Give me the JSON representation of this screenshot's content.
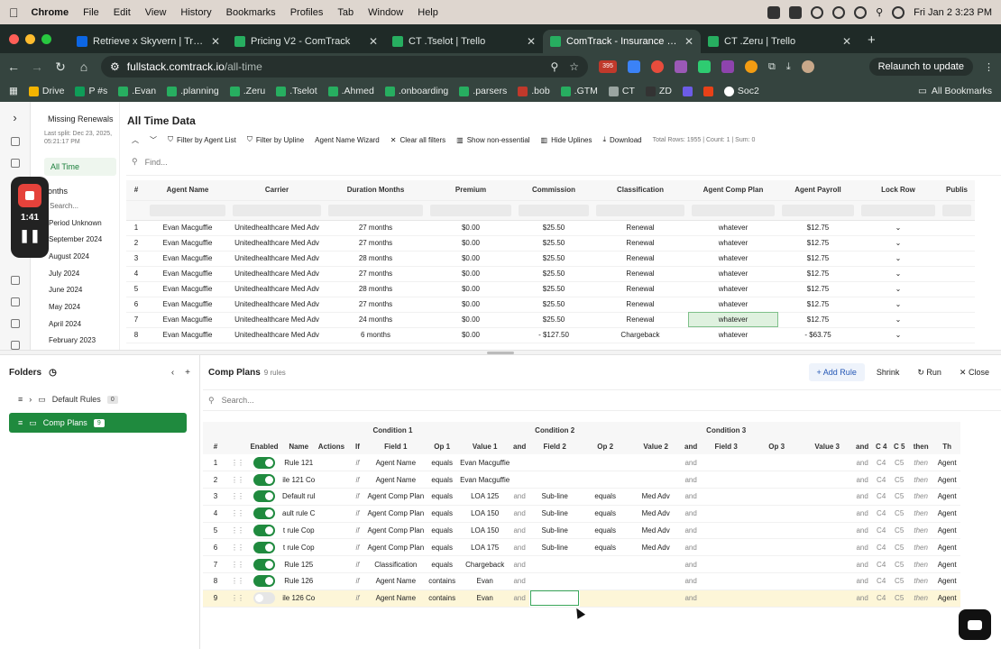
{
  "menubar": {
    "app": "Chrome",
    "items": [
      "File",
      "Edit",
      "View",
      "History",
      "Bookmarks",
      "Profiles",
      "Tab",
      "Window",
      "Help"
    ],
    "datetime": "Fri Jan 2  3:23 PM"
  },
  "tabs": [
    {
      "label": "Retrieve x Skyvern | Trello",
      "color": "#0c66e4",
      "active": false
    },
    {
      "label": "Pricing V2 - ComTrack",
      "color": "#27ae60",
      "active": false
    },
    {
      "label": "CT .Tselot | Trello",
      "color": "#27ae60",
      "active": false
    },
    {
      "label": "ComTrack - Insurance Comm",
      "color": "#27ae60",
      "active": true
    },
    {
      "label": "CT .Zeru | Trello",
      "color": "#27ae60",
      "active": false
    }
  ],
  "address": {
    "host": "fullstack.comtrack.io",
    "path": "/all-time",
    "relaunch": "Relaunch to update",
    "badge": "395"
  },
  "bookmarks": [
    "Drive",
    "P #s",
    ".Evan",
    ".planning",
    ".Zeru",
    ".Tselot",
    ".Ahmed",
    ".onboarding",
    ".parsers",
    ".bob",
    ".GTM",
    "CT",
    "ZD",
    "Soc2"
  ],
  "bookmarks_all": "All Bookmarks",
  "recorder": {
    "time": "1:41"
  },
  "period_panel": {
    "title": "Missing Renewals",
    "last_split": "Last split: Dec 23, 2025, 05:21:17 PM",
    "all_time": "All Time",
    "months": "onths",
    "search": "Search...",
    "items": [
      "Period Unknown",
      "September 2024",
      "August 2024",
      "July 2024",
      "June 2024",
      "May 2024",
      "April 2024",
      "February 2023"
    ]
  },
  "all_time": {
    "title": "All Time Data",
    "toolbar": {
      "filter_agent": "Filter by Agent List",
      "filter_upline": "Filter by Upline",
      "wizard": "Agent Name Wizard",
      "clear": "Clear all filters",
      "non_essential": "Show non-essential",
      "hide_uplines": "Hide Uplines",
      "download": "Download",
      "summary": "Total Rows: 1955 | Count: 1 | Sum: 0"
    },
    "find": "Find...",
    "headers": [
      "#",
      "Agent Name",
      "Carrier",
      "Duration Months",
      "Premium",
      "Commission",
      "Classification",
      "Agent Comp Plan",
      "Agent Payroll",
      "Lock Row",
      "Publis"
    ],
    "rows": [
      [
        "1",
        "Evan Macguffie",
        "Unitedhealthcare Med Adv",
        "27 months",
        "$0.00",
        "$25.50",
        "Renewal",
        "whatever",
        "$12.75"
      ],
      [
        "2",
        "Evan Macguffie",
        "Unitedhealthcare Med Adv",
        "27 months",
        "$0.00",
        "$25.50",
        "Renewal",
        "whatever",
        "$12.75"
      ],
      [
        "3",
        "Evan Macguffie",
        "Unitedhealthcare Med Adv",
        "28 months",
        "$0.00",
        "$25.50",
        "Renewal",
        "whatever",
        "$12.75"
      ],
      [
        "4",
        "Evan Macguffie",
        "Unitedhealthcare Med Adv",
        "27 months",
        "$0.00",
        "$25.50",
        "Renewal",
        "whatever",
        "$12.75"
      ],
      [
        "5",
        "Evan Macguffie",
        "Unitedhealthcare Med Adv",
        "28 months",
        "$0.00",
        "$25.50",
        "Renewal",
        "whatever",
        "$12.75"
      ],
      [
        "6",
        "Evan Macguffie",
        "Unitedhealthcare Med Adv",
        "27 months",
        "$0.00",
        "$25.50",
        "Renewal",
        "whatever",
        "$12.75"
      ],
      [
        "7",
        "Evan Macguffie",
        "Unitedhealthcare Med Adv",
        "24 months",
        "$0.00",
        "$25.50",
        "Renewal",
        "whatever",
        "$12.75"
      ],
      [
        "8",
        "Evan Macguffie",
        "Unitedhealthcare Med Adv",
        "6 months",
        "$0.00",
        "- $127.50",
        "Chargeback",
        "whatever",
        "- $63.75"
      ]
    ]
  },
  "folders": {
    "title": "Folders",
    "items": [
      {
        "label": "Default Rules",
        "count": "0"
      },
      {
        "label": "Comp Plans",
        "count": "9"
      }
    ]
  },
  "comp_plans": {
    "title": "Comp Plans",
    "count": "9 rules",
    "add_rule": "Add Rule",
    "shrink": "Shrink",
    "run": "Run",
    "close": "Close",
    "search": "Search...",
    "group_headers": [
      "Condition 1",
      "Condition 2",
      "Condition 3"
    ],
    "headers": [
      "#",
      "",
      "Enabled",
      "Name",
      "Actions",
      "If",
      "Field 1",
      "Op 1",
      "Value 1",
      "and",
      "Field 2",
      "Op 2",
      "Value 2",
      "and",
      "Field 3",
      "Op 3",
      "Value 3",
      "and",
      "C 4",
      "C 5",
      "then",
      "Th"
    ],
    "rows": [
      {
        "n": "1",
        "on": true,
        "name": "Rule 121",
        "f1": "Agent Name",
        "o1": "equals",
        "v1": "Evan Macguffie",
        "a1": "",
        "f2": "",
        "o2": "",
        "v2": ""
      },
      {
        "n": "2",
        "on": true,
        "name": "ile 121 Co",
        "f1": "Agent Name",
        "o1": "equals",
        "v1": "Evan Macguffie",
        "a1": "",
        "f2": "",
        "o2": "",
        "v2": ""
      },
      {
        "n": "3",
        "on": true,
        "name": "Default rul",
        "f1": "Agent Comp Plan",
        "o1": "equals",
        "v1": "LOA 125",
        "a1": "and",
        "f2": "Sub-line",
        "o2": "equals",
        "v2": "Med Adv"
      },
      {
        "n": "4",
        "on": true,
        "name": "ault rule C",
        "f1": "Agent Comp Plan",
        "o1": "equals",
        "v1": "LOA 150",
        "a1": "and",
        "f2": "Sub-line",
        "o2": "equals",
        "v2": "Med Adv"
      },
      {
        "n": "5",
        "on": true,
        "name": "t rule Cop",
        "f1": "Agent Comp Plan",
        "o1": "equals",
        "v1": "LOA 150",
        "a1": "and",
        "f2": "Sub-line",
        "o2": "equals",
        "v2": "Med Adv"
      },
      {
        "n": "6",
        "on": true,
        "name": "t rule Cop",
        "f1": "Agent Comp Plan",
        "o1": "equals",
        "v1": "LOA 175",
        "a1": "and",
        "f2": "Sub-line",
        "o2": "equals",
        "v2": "Med Adv"
      },
      {
        "n": "7",
        "on": true,
        "name": "Rule 125",
        "f1": "Classification",
        "o1": "equals",
        "v1": "Chargeback",
        "a1": "and",
        "f2": "",
        "o2": "",
        "v2": ""
      },
      {
        "n": "8",
        "on": true,
        "name": "Rule 126",
        "f1": "Agent Name",
        "o1": "contains",
        "v1": "Evan",
        "a1": "and",
        "f2": "",
        "o2": "",
        "v2": ""
      },
      {
        "n": "9",
        "on": false,
        "name": "ile 126 Co",
        "f1": "Agent Name",
        "o1": "contains",
        "v1": "Evan",
        "a1": "and",
        "f2": "",
        "o2": "",
        "v2": ""
      }
    ],
    "cell_labels": {
      "if": "if",
      "and": "and",
      "c4": "C4",
      "c5": "C5",
      "then": "then",
      "th": "Agent"
    }
  }
}
